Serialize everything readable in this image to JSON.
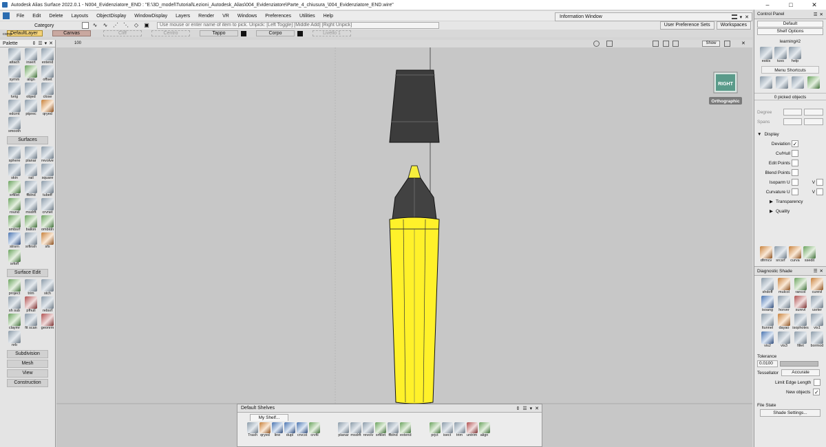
{
  "window": {
    "title": "Autodesk Alias Surface 2022.0.1   - N004_Evidenziatore_END : \"E:\\3D_model\\Tutorial\\Lezioni_Autodesk_Alias\\004_Evidenziatore\\Parte_4_chiusura_\\004_Evidenziatore_END.wire\"",
    "controls": [
      "–",
      "□",
      "✕"
    ]
  },
  "menu": [
    "File",
    "Edit",
    "Delete",
    "Layouts",
    "ObjectDisplay",
    "WindowDisplay",
    "Layers",
    "Render",
    "VR",
    "Windows",
    "Preferences",
    "Utilities",
    "Help"
  ],
  "toolbar": {
    "category_label": "Category",
    "prompt": "Use mouse or enter name of item to pick. Unpick: [Left Toggle]  [Middle Add]  [Right Unpick]",
    "user_prefs": "User Preference Sets",
    "workspaces": "Workspaces"
  },
  "layers": [
    "DefaultLayer",
    "Canvas",
    "Cliff",
    "Centro",
    "Tappo",
    "Corpo",
    "Livello 1"
  ],
  "info_window": "Information Window",
  "palette": {
    "title": "Palette",
    "comp_label": "comp",
    "group1": [
      {
        "label": "attach",
        "icon": "attach-icon"
      },
      {
        "label": "insert",
        "icon": "insert-icon"
      },
      {
        "label": "extend",
        "icon": "extend-icon"
      },
      {
        "label": "symm",
        "icon": "symm-icon"
      },
      {
        "label": "align",
        "icon": "align-icon"
      },
      {
        "label": "offset",
        "icon": "offset-icon"
      },
      {
        "label": "tvrig",
        "icon": "tvrig-icon"
      },
      {
        "label": "objed",
        "icon": "objed-icon"
      },
      {
        "label": "close",
        "icon": "close-icon"
      },
      {
        "label": "edcrnt",
        "icon": "edcrnt-icon"
      },
      {
        "label": "ptprec",
        "icon": "ptprec-icon"
      },
      {
        "label": "qryed",
        "icon": "qryed-icon"
      },
      {
        "label": "smooth",
        "icon": "smooth-icon"
      }
    ],
    "surfaces_title": "Surfaces",
    "surfaces": [
      {
        "label": "sphere",
        "icon": "sphere-icon"
      },
      {
        "label": "planar",
        "icon": "planar-icon"
      },
      {
        "label": "revolve",
        "icon": "revolve-icon"
      },
      {
        "label": "skin",
        "icon": "skin-icon"
      },
      {
        "label": "rail",
        "icon": "rail-icon"
      },
      {
        "label": "square",
        "icon": "square-icon"
      },
      {
        "label": "srfillet",
        "icon": "srfillet-icon"
      },
      {
        "label": "ffblnd",
        "icon": "ffblnd-icon"
      },
      {
        "label": "tubeff",
        "icon": "tubeff-icon"
      },
      {
        "label": "round",
        "icon": "round-icon"
      },
      {
        "label": "msdrft",
        "icon": "msdrft-icon"
      },
      {
        "label": "crvnet",
        "icon": "crvnet-icon"
      },
      {
        "label": "smbsrf",
        "icon": "smbsrf-icon"
      },
      {
        "label": "ballon",
        "icon": "ballon-icon"
      },
      {
        "label": "ombldn",
        "icon": "ombldn-icon"
      },
      {
        "label": "strsrn",
        "icon": "strsrn-icon"
      },
      {
        "label": "srfinsh",
        "icon": "srfinsh-icon"
      },
      {
        "label": "sfs",
        "icon": "sfs-icon"
      },
      {
        "label": "srfoff",
        "icon": "srfoff-icon"
      }
    ],
    "surface_edit_title": "Surface Edit",
    "surface_edit": [
      {
        "label": "project",
        "icon": "project-icon"
      },
      {
        "label": "trim",
        "icon": "trim-icon"
      },
      {
        "label": "stch",
        "icon": "stch-icon"
      },
      {
        "label": "sh sub",
        "icon": "shsub-icon"
      },
      {
        "label": "pfhull",
        "icon": "pfhull-icon"
      },
      {
        "label": "rebsrf",
        "icon": "rebsrf-icon"
      },
      {
        "label": "claymr",
        "icon": "claymr-icon"
      },
      {
        "label": "fit scan",
        "icon": "fitscan-icon"
      },
      {
        "label": "geonrm",
        "icon": "geonrm-icon"
      },
      {
        "label": "nrb",
        "icon": "nrb-icon"
      }
    ],
    "sections": [
      "Subdivision",
      "Mesh",
      "View",
      "Construction"
    ]
  },
  "viewport": {
    "view_cube": "RIGHT",
    "projection": "Orthographic",
    "show_label": "Show",
    "zoom_readout": "100",
    "colors": {
      "body": "#fff12a",
      "cap": "#3c3c3c",
      "tip": "#f6ee3c",
      "background": "#c7c7c7"
    }
  },
  "control_panel": {
    "title": "Control Panel",
    "preset": "Default",
    "shelf_options": "Shelf Options",
    "tab": "learning#2",
    "shelf": [
      {
        "label": "eskls",
        "icon": "eskls-icon"
      },
      {
        "label": "tuvs",
        "icon": "tuvs-icon"
      },
      {
        "label": "help",
        "icon": "help-icon"
      }
    ],
    "menu_shortcuts": "Menu Shortcuts",
    "picked": "0 picked objects",
    "degree_label": "Degree",
    "spans_label": "Spans",
    "display_label": "Display",
    "display_items": [
      {
        "label": "Deviation",
        "checked": true
      },
      {
        "label": "Cv/Hull",
        "checked": false
      },
      {
        "label": "Edit Points",
        "checked": false
      },
      {
        "label": "Blend Points",
        "checked": false
      },
      {
        "label": "Isoparm U",
        "checked": false
      },
      {
        "label": "Curvature U",
        "checked": false
      }
    ],
    "v_label": "V",
    "transparency": "Transparency",
    "quality": "Quality",
    "bottom_shelf": [
      {
        "label": "dfrmcv",
        "icon": "dfrmcv-icon"
      },
      {
        "label": "srcsrf",
        "icon": "srcsrf-icon"
      },
      {
        "label": "curva",
        "icon": "curva-icon"
      },
      {
        "label": "ssedit",
        "icon": "ssedit-icon"
      }
    ]
  },
  "diagnostic": {
    "title": "Diagnostic Shade",
    "tools": [
      {
        "label": "shdoff",
        "icon": "shdoff-icon"
      },
      {
        "label": "mulcol",
        "icon": "mulcol-icon"
      },
      {
        "label": "rancol",
        "icon": "rancol-icon"
      },
      {
        "label": "curevl",
        "icon": "curevl-icon"
      },
      {
        "label": "isoang",
        "icon": "isoang-icon"
      },
      {
        "label": "horver",
        "icon": "horver-icon"
      },
      {
        "label": "surevl",
        "icon": "surevl-icon"
      },
      {
        "label": "usrter",
        "icon": "usrter-icon"
      },
      {
        "label": "ltunnel",
        "icon": "ltunnel-icon"
      },
      {
        "label": "dayao",
        "icon": "dayao-icon"
      },
      {
        "label": "isophotes",
        "icon": "isophotes-icon"
      },
      {
        "label": "vis1",
        "icon": "vis1-icon"
      },
      {
        "label": "vis2",
        "icon": "vis2-icon"
      },
      {
        "label": "vis3",
        "icon": "vis3-icon"
      },
      {
        "label": "fillet",
        "icon": "fillet-icon"
      },
      {
        "label": "bormod",
        "icon": "bormod-icon"
      }
    ],
    "tolerance_label": "Tolerance",
    "tolerance_value": "0.0100",
    "tessellator_label": "Tessellator",
    "tessellator_value": "Accurate",
    "limit_edge": "Limit Edge Length",
    "new_objects": "New objects",
    "file_state": "File State",
    "shade_settings": "Shade Settings..."
  },
  "shelves": {
    "title": "Default Shelves",
    "tab": "My Shelf...",
    "tools": [
      {
        "label": "Trash",
        "icon": "trash-icon"
      },
      {
        "label": "qryed",
        "icon": "qryed-icon"
      },
      {
        "label": "line",
        "icon": "line-icon"
      },
      {
        "label": "dupl",
        "icon": "dupl-icon"
      },
      {
        "label": "crvcst",
        "icon": "crvcst-icon"
      },
      {
        "label": "crvfil",
        "icon": "crvfil-icon"
      },
      {
        "label": "planar",
        "icon": "planar-icon"
      },
      {
        "label": "msdrft",
        "icon": "msdrft-icon"
      },
      {
        "label": "revolv",
        "icon": "revolv-icon"
      },
      {
        "label": "srfillet",
        "icon": "srfillet-icon"
      },
      {
        "label": "ffblnd",
        "icon": "ffblnd-icon"
      },
      {
        "label": "extend",
        "icon": "extend-icon"
      },
      {
        "label": "prjct",
        "icon": "prjct-icon"
      },
      {
        "label": "isect",
        "icon": "isect-icon"
      },
      {
        "label": "trim",
        "icon": "trim-icon"
      },
      {
        "label": "untrim",
        "icon": "untrim-icon"
      },
      {
        "label": "align",
        "icon": "align-icon"
      }
    ]
  }
}
